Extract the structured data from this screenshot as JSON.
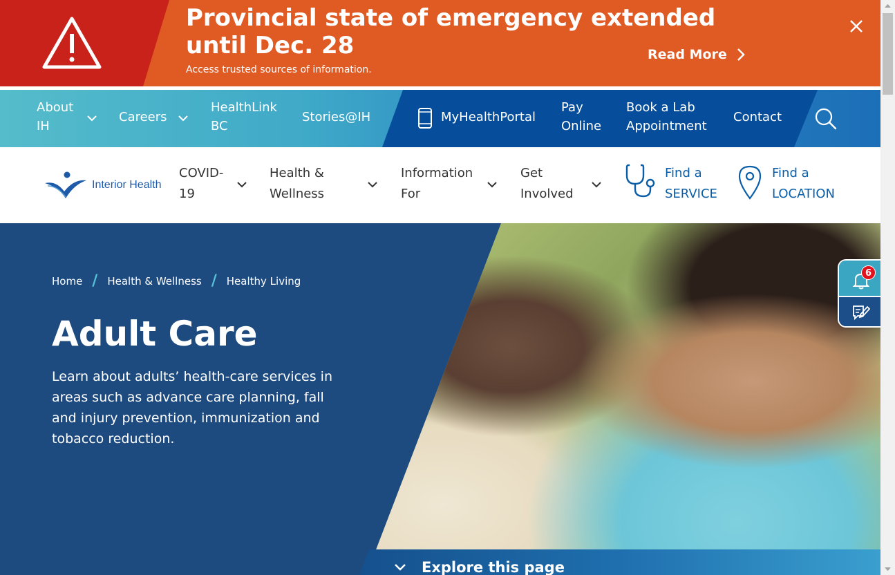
{
  "alert": {
    "title": "Provincial state of emergency extended until Dec. 28",
    "subtitle": "Access trusted sources of information.",
    "read_more": "Read More"
  },
  "topbar": {
    "about": "About IH",
    "careers": "Careers",
    "healthlink": "HealthLink BC",
    "stories": "Stories@IH",
    "myhealthportal": "MyHealthPortal",
    "pay_online": "Pay Online",
    "book_lab": "Book a Lab Appointment",
    "contact": "Contact"
  },
  "logo": {
    "text": "Interior Health"
  },
  "nav": {
    "covid": "COVID-19",
    "health": "Health & Wellness",
    "info": "Information For",
    "involved": "Get Involved",
    "find_service_top": "Find a",
    "find_service_bottom": "SERVICE",
    "find_location_top": "Find a",
    "find_location_bottom": "LOCATION"
  },
  "breadcrumb": [
    "Home",
    "Health & Wellness",
    "Healthy Living"
  ],
  "hero": {
    "title": "Adult Care",
    "description": "Learn about adults’ health-care services in areas such as advance care planning, fall and injury prevention, immunization and tobacco reduction.",
    "explore": "Explore this page"
  },
  "side_widget": {
    "notification_count": "6"
  },
  "colors": {
    "alert": "#e05a24",
    "alert_icon_bg": "#c8221a",
    "topbar_light": "#55bccb",
    "topbar_dark": "#064e9b",
    "hero_bg": "#1d4a7f",
    "accent": "#0a5ea8"
  }
}
